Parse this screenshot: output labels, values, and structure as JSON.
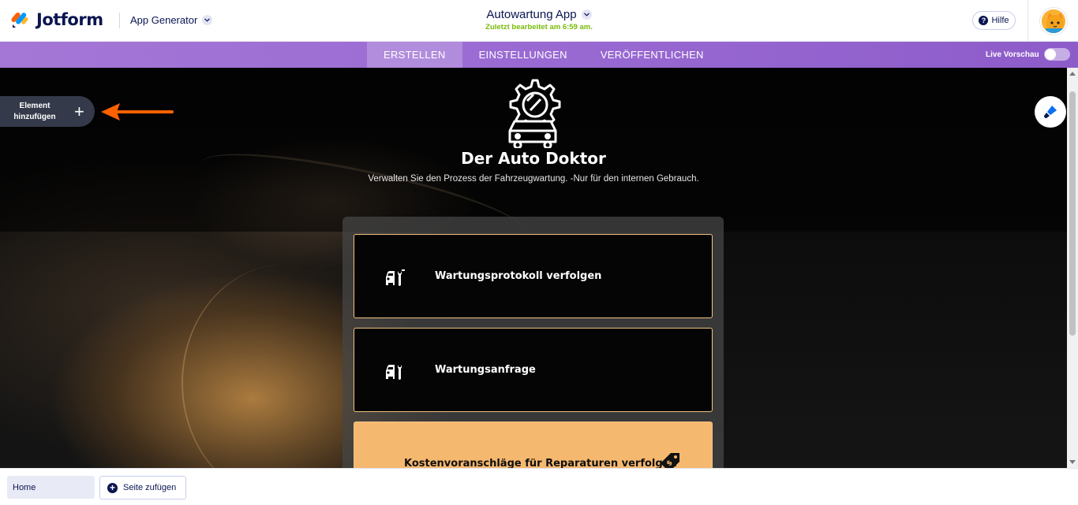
{
  "header": {
    "brand": "Jotform",
    "product": "App Generator",
    "app_title": "Autowartung App",
    "last_edited": "Zuletzt bearbeitet am 6:59 am.",
    "help_label": "Hilfe"
  },
  "nav": {
    "tabs": [
      {
        "label": "ERSTELLEN",
        "active": true
      },
      {
        "label": "EINSTELLUNGEN",
        "active": false
      },
      {
        "label": "VERÖFFENTLICHEN",
        "active": false
      }
    ],
    "live_preview_label": "Live Vorschau"
  },
  "canvas": {
    "add_element_label": "Element hinzufügen",
    "hero_title": "Der Auto Doktor",
    "hero_subtitle": "Verwalten Sie den Prozess der Fahrzeugwartung. -Nur für den internen Gebrauch.",
    "cards": [
      {
        "label": "Wartungsprotokoll verfolgen",
        "icon": "car-wrench-icon"
      },
      {
        "label": "Wartungsanfrage",
        "icon": "car-wrench-icon"
      },
      {
        "label": "Kostenvoranschläge für Reparaturen verfolgen",
        "icon": "price-tag-icon"
      }
    ]
  },
  "footer": {
    "home_label": "Home",
    "add_page_label": "Seite zufügen"
  },
  "colors": {
    "brand_navy": "#0a1551",
    "nav_purple": "#9a6ad3",
    "accent_orange": "#ff6100",
    "card_orange": "#f5b86f",
    "edited_green": "#78bb07"
  }
}
